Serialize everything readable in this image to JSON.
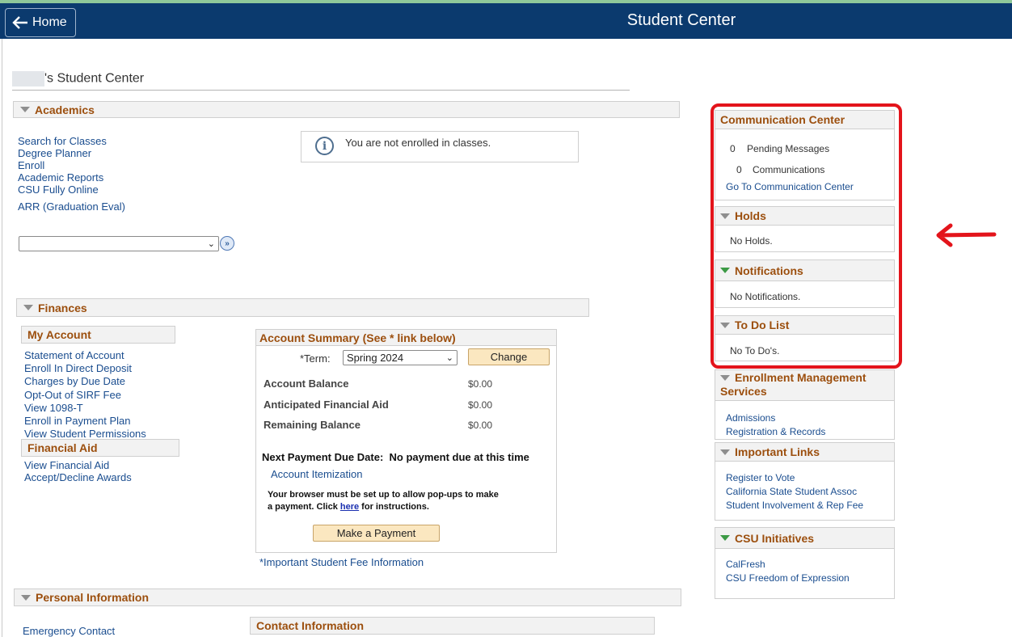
{
  "header": {
    "home_label": "Home",
    "title": "Student Center"
  },
  "student_center_title": "'s Student Center",
  "academics": {
    "heading": "Academics",
    "links": [
      "Search for Classes",
      "Degree Planner",
      "Enroll",
      "Academic Reports",
      "CSU Fully Online"
    ],
    "arr_link": "ARR (Graduation Eval)",
    "notice": "You are not enrolled in classes.",
    "select_value": ""
  },
  "finances": {
    "heading": "Finances",
    "my_account": {
      "heading": "My Account",
      "links": [
        "Statement of Account",
        "Enroll In Direct Deposit",
        "Charges by Due Date",
        "Opt-Out of SIRF Fee",
        "View 1098-T",
        "Enroll in Payment Plan",
        "View Student Permissions"
      ]
    },
    "financial_aid": {
      "heading": "Financial Aid",
      "links": [
        "View Financial Aid",
        "Accept/Decline Awards"
      ]
    },
    "summary": {
      "heading": "Account Summary (See * link below)",
      "term_label": "*Term:",
      "term_value": "Spring 2024",
      "change_label": "Change",
      "rows": [
        {
          "label": "Account Balance",
          "value": "$0.00"
        },
        {
          "label": "Anticipated Financial Aid",
          "value": "$0.00"
        },
        {
          "label": "Remaining Balance",
          "value": "$0.00"
        }
      ],
      "next_due_label": "Next Payment Due Date:",
      "next_due_value": "No payment due at this time",
      "itemization_link": "Account Itemization",
      "popup_note_1": "Your browser must be set up to allow pop-ups to make",
      "popup_note_2_before": "a payment. Click ",
      "popup_note_here": "here",
      "popup_note_2_after": " for instructions.",
      "pay_button": "Make a Payment"
    },
    "fee_link": "*Important Student Fee Information"
  },
  "personal_info": {
    "heading": "Personal Information",
    "emergency_link": "Emergency Contact",
    "contact_heading": "Contact Information"
  },
  "right": {
    "comm_center": {
      "heading": "Communication Center",
      "pending_count": "0",
      "pending_label": "Pending Messages",
      "comm_count": "0",
      "comm_label": "Communications",
      "link": "Go To Communication Center"
    },
    "holds": {
      "heading": "Holds",
      "text": "No Holds."
    },
    "notifications": {
      "heading": "Notifications",
      "text": "No Notifications."
    },
    "todo": {
      "heading": "To Do List",
      "text": "No To Do's."
    },
    "enrollment": {
      "heading_1": "Enrollment Management",
      "heading_2": "Services",
      "links": [
        "Admissions",
        "Registration & Records"
      ]
    },
    "important_links": {
      "heading": "Important Links",
      "links": [
        "Register to Vote",
        "California State Student Assoc",
        "Student Involvement & Rep Fee"
      ]
    },
    "csu": {
      "heading": "CSU Initiatives",
      "links": [
        "CalFresh",
        "CSU Freedom of Expression"
      ]
    }
  },
  "colors": {
    "header_bg": "#0b3a6e",
    "section_text": "#9c4f0e",
    "link": "#1a4d8f",
    "highlight": "#e3141b"
  }
}
